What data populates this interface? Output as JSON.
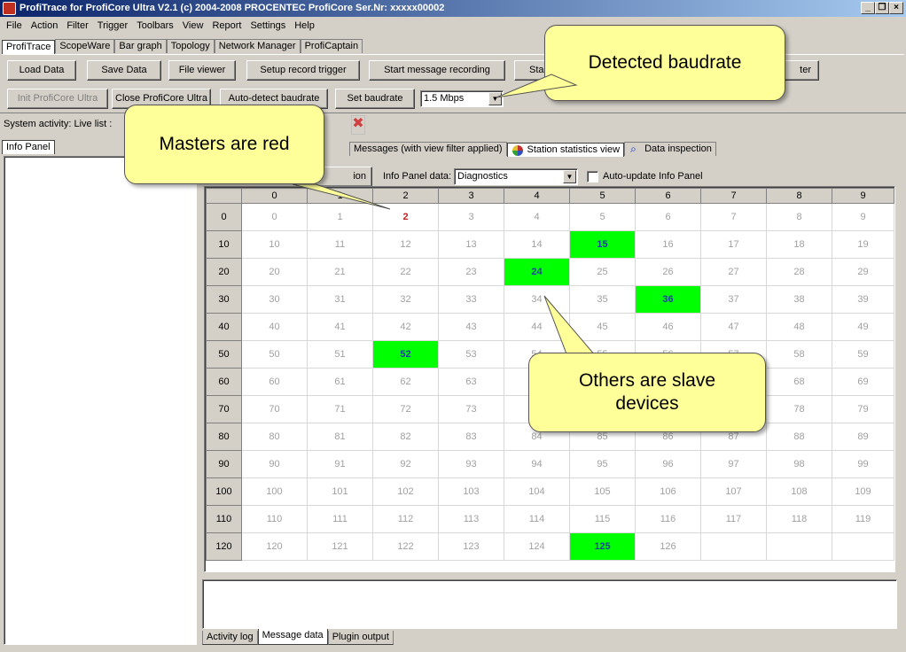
{
  "window": {
    "title": "ProfiTrace for ProfiCore Ultra V2.1 (c) 2004-2008 PROCENTEC  ProfiCore Ser.Nr: xxxxx00002",
    "controls": [
      "_",
      "×"
    ]
  },
  "menu": [
    "File",
    "Action",
    "Filter",
    "Trigger",
    "Toolbars",
    "View",
    "Report",
    "Settings",
    "Help"
  ],
  "main_tabs": [
    "ProfiTrace",
    "ScopeWare",
    "Bar graph",
    "Topology",
    "Network Manager",
    "ProfiCaptain"
  ],
  "toolbar1": {
    "load": "Load Data",
    "save": "Save Data",
    "file_viewer": "File viewer",
    "setup_trigger": "Setup record trigger",
    "start_msg": "Start message recording",
    "start_partial": "Sta",
    "filter_partial": "ter"
  },
  "toolbar2": {
    "init": "Init ProfiCore Ultra",
    "close": "Close ProfiCore Ultra",
    "autodetect": "Auto-detect baudrate",
    "set_baud": "Set baudrate",
    "baud_value": "1.5 Mbps"
  },
  "status": {
    "activity": "System activity:  Live list :"
  },
  "info_panel": {
    "tab": "Info Panel"
  },
  "view_tabs": {
    "messages": "Messages (with view filter applied)",
    "station_stats": "Station statistics view",
    "data_inspection": "Data inspection"
  },
  "info_controls": {
    "partial_button": "ion",
    "info_data_label": "Info Panel data:",
    "info_data_value": "Diagnostics",
    "auto_update": "Auto-update Info Panel"
  },
  "grid": {
    "columns": [
      "0",
      "1",
      "2",
      "3",
      "4",
      "5",
      "6",
      "7",
      "8",
      "9"
    ],
    "rows": [
      "0",
      "10",
      "20",
      "30",
      "40",
      "50",
      "60",
      "70",
      "80",
      "90",
      "100",
      "110",
      "120"
    ],
    "masters": [
      2
    ],
    "slaves": [
      15,
      24,
      36,
      52,
      125
    ],
    "max_address": 126
  },
  "bottom_tabs": [
    "Activity log",
    "Message data",
    "Plugin output"
  ],
  "callouts": {
    "baudrate": "Detected baudrate",
    "masters": "Masters are red",
    "slaves_line1": "Others are slave",
    "slaves_line2": "devices"
  },
  "colors": {
    "master_text": "#c81e1e",
    "slave_bg": "#00ff00",
    "slave_text": "#1f3fa0",
    "callout_bg": "#ffff99"
  }
}
